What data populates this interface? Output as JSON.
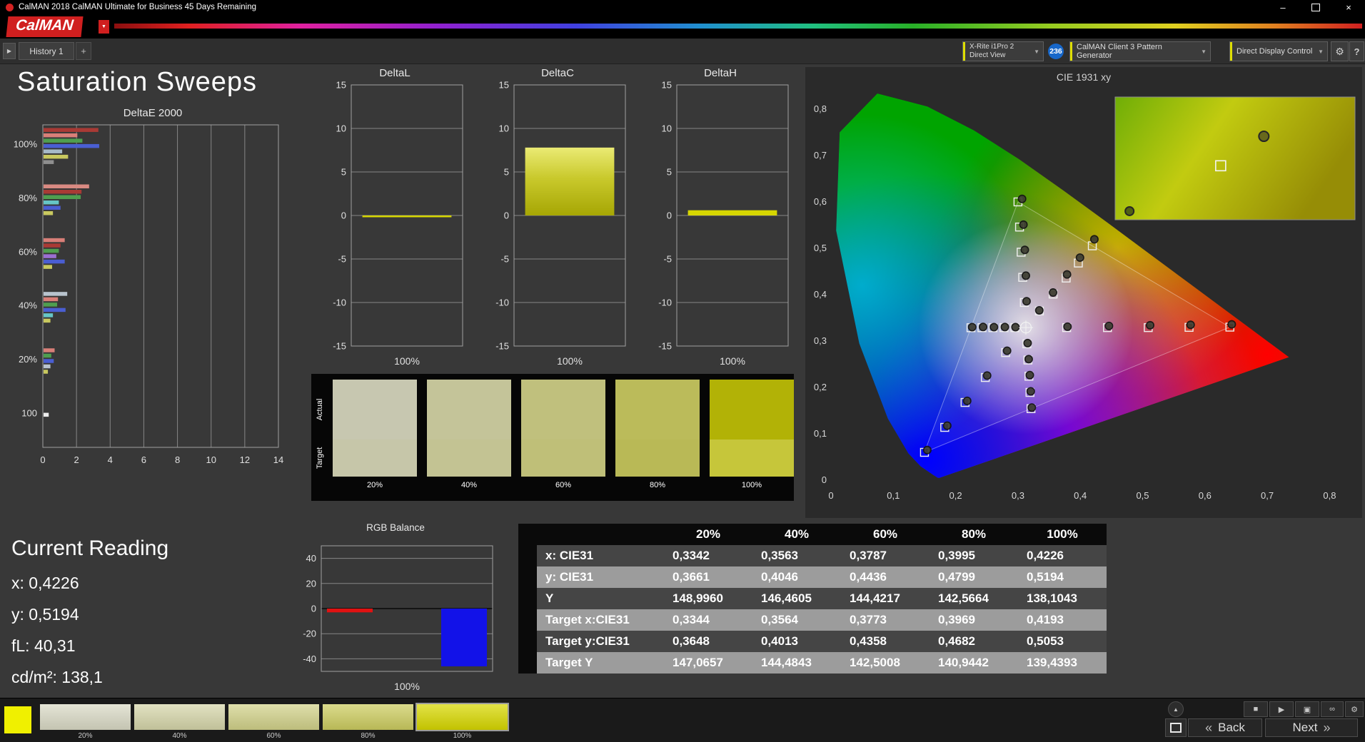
{
  "window": {
    "title": "CalMAN 2018 CalMAN Ultimate for Business 45 Days Remaining",
    "minimize": "–",
    "close": "×"
  },
  "brand": {
    "logo_text": "CalMAN",
    "dropdown_icon": "▼"
  },
  "toolbar": {
    "expander_icon": "▶",
    "history_tab": "History 1",
    "add_tab": "+",
    "meter_line1": "X-Rite i1Pro 2",
    "meter_line2": "Direct View",
    "badge": "236",
    "pattern_generator": "CalMAN Client 3 Pattern Generator",
    "display_control": "Direct Display Control",
    "dropdown_icon": "▼",
    "gear_icon": "⚙",
    "help_icon": "?"
  },
  "page": {
    "title": "Saturation Sweeps"
  },
  "current_reading": {
    "heading": "Current Reading",
    "lines": [
      "x: 0,4226",
      "y: 0,5194",
      "fL: 40,31",
      "cd/m²: 138,1"
    ]
  },
  "swatches": {
    "actual_label": "Actual",
    "target_label": "Target",
    "items": [
      {
        "label": "20%",
        "actual": "#c7c7b0",
        "target": "#c6c6a9"
      },
      {
        "label": "40%",
        "actual": "#c4c499",
        "target": "#c3c393"
      },
      {
        "label": "60%",
        "actual": "#c0c07d",
        "target": "#bfbf78"
      },
      {
        "label": "80%",
        "actual": "#bbbb5a",
        "target": "#b9b956"
      },
      {
        "label": "100%",
        "actual": "#b2b206",
        "target": "#c6c63a"
      }
    ]
  },
  "table": {
    "headers": [
      "20%",
      "40%",
      "60%",
      "80%",
      "100%"
    ],
    "rows": [
      {
        "label": "x: CIE31",
        "values": [
          "0,3342",
          "0,3563",
          "0,3787",
          "0,3995",
          "0,4226"
        ]
      },
      {
        "label": "y: CIE31",
        "values": [
          "0,3661",
          "0,4046",
          "0,4436",
          "0,4799",
          "0,5194"
        ]
      },
      {
        "label": "Y",
        "values": [
          "148,9960",
          "146,4605",
          "144,4217",
          "142,5664",
          "138,1043"
        ]
      },
      {
        "label": "Target x:CIE31",
        "values": [
          "0,3344",
          "0,3564",
          "0,3773",
          "0,3969",
          "0,4193"
        ]
      },
      {
        "label": "Target y:CIE31",
        "values": [
          "0,3648",
          "0,4013",
          "0,4358",
          "0,4682",
          "0,5053"
        ]
      },
      {
        "label": "Target Y",
        "values": [
          "147,0657",
          "144,4843",
          "142,5008",
          "140,9442",
          "139,4393"
        ]
      }
    ]
  },
  "bottom_bar": {
    "current_color": "#f0f000",
    "back_label": "Back",
    "next_label": "Next",
    "back_chevron": "«",
    "next_chevron": "»",
    "icons": {
      "collapse": "▲",
      "stop": "■",
      "play": "▶",
      "snapshot": "▣",
      "loop": "∞",
      "settings": "⚙"
    },
    "thumbnails": [
      {
        "label": "20%",
        "color": "#dadac6",
        "selected": false
      },
      {
        "label": "40%",
        "color": "#d6d6aa",
        "selected": false
      },
      {
        "label": "60%",
        "color": "#d2d28a",
        "selected": false
      },
      {
        "label": "80%",
        "color": "#cdcd60",
        "selected": false
      },
      {
        "label": "100%",
        "color": "#d8d800",
        "selected": true
      }
    ]
  },
  "chart_data": [
    {
      "id": "deltae2000",
      "type": "bar",
      "orientation": "horizontal",
      "title": "DeltaE 2000",
      "xlim": [
        0,
        14
      ],
      "xticks": [
        0,
        2,
        4,
        6,
        8,
        10,
        12,
        14
      ],
      "groups": [
        {
          "label": "100%",
          "bars": [
            {
              "color": "#a93a35",
              "value": 3.3
            },
            {
              "color": "#d97f78",
              "value": 2.05
            },
            {
              "color": "#4f9e4f",
              "value": 2.35
            },
            {
              "color": "#4a5ed2",
              "value": 3.35
            },
            {
              "color": "#a7bac9",
              "value": 1.15
            },
            {
              "color": "#c9c95f",
              "value": 1.5
            },
            {
              "color": "#8f8f8f",
              "value": 0.65
            }
          ]
        },
        {
          "label": "80%",
          "bars": [
            {
              "color": "#d98a82",
              "value": 2.75
            },
            {
              "color": "#a93a35",
              "value": 2.3
            },
            {
              "color": "#4f9e4f",
              "value": 2.25
            },
            {
              "color": "#66c6c6",
              "value": 0.95
            },
            {
              "color": "#4a5ed2",
              "value": 1.05
            },
            {
              "color": "#c9c95f",
              "value": 0.6
            }
          ]
        },
        {
          "label": "60%",
          "bars": [
            {
              "color": "#d97f78",
              "value": 1.3
            },
            {
              "color": "#a93a35",
              "value": 1.05
            },
            {
              "color": "#4f9e4f",
              "value": 0.95
            },
            {
              "color": "#9a6fd2",
              "value": 0.8
            },
            {
              "color": "#4a5ed2",
              "value": 1.3
            },
            {
              "color": "#c9c95f",
              "value": 0.55
            }
          ]
        },
        {
          "label": "40%",
          "bars": [
            {
              "color": "#b9c4ce",
              "value": 1.45
            },
            {
              "color": "#d97f78",
              "value": 0.9
            },
            {
              "color": "#4f9e4f",
              "value": 0.85
            },
            {
              "color": "#4a5ed2",
              "value": 1.35
            },
            {
              "color": "#66c6c6",
              "value": 0.6
            },
            {
              "color": "#c9c95f",
              "value": 0.45
            }
          ]
        },
        {
          "label": "20%",
          "bars": [
            {
              "color": "#d97f78",
              "value": 0.7
            },
            {
              "color": "#4f9e4f",
              "value": 0.5
            },
            {
              "color": "#4a5ed2",
              "value": 0.65
            },
            {
              "color": "#b9c4ce",
              "value": 0.45
            },
            {
              "color": "#c9c95f",
              "value": 0.3
            }
          ]
        },
        {
          "label": "100",
          "bars": [
            {
              "color": "#ececec",
              "value": 0.35
            }
          ]
        }
      ]
    },
    {
      "id": "deltal",
      "type": "bar",
      "title": "DeltaL",
      "ylim": [
        -15,
        15
      ],
      "yticks": [
        15,
        10,
        5,
        0,
        -5,
        -10,
        -15
      ],
      "xlabel": "100%",
      "bars": [
        {
          "value": -0.2,
          "color": "#d6d600"
        }
      ]
    },
    {
      "id": "deltac",
      "type": "bar",
      "title": "DeltaC",
      "ylim": [
        -15,
        15
      ],
      "yticks": [
        15,
        10,
        5,
        0,
        -5,
        -10,
        -15
      ],
      "xlabel": "100%",
      "bars": [
        {
          "value": 7.8,
          "color": "gradYellow"
        }
      ]
    },
    {
      "id": "deltah",
      "type": "bar",
      "title": "DeltaH",
      "ylim": [
        -15,
        15
      ],
      "yticks": [
        15,
        10,
        5,
        0,
        -5,
        -10,
        -15
      ],
      "xlabel": "100%",
      "bars": [
        {
          "value": 0.6,
          "color": "#d6d600"
        }
      ]
    },
    {
      "id": "rgb_balance",
      "type": "bar",
      "title": "RGB Balance",
      "ylim": [
        -50,
        50
      ],
      "yticks": [
        40,
        20,
        0,
        -20,
        -40
      ],
      "xlabel": "100%",
      "bars": [
        {
          "name": "red",
          "value": -3,
          "color": "#e01212"
        },
        {
          "name": "green",
          "value": 0,
          "color": "#12b412"
        },
        {
          "name": "blue",
          "value": -46,
          "color": "#1212e8"
        }
      ]
    },
    {
      "id": "cie1931",
      "type": "scatter",
      "title": "CIE 1931 xy",
      "xticks": [
        "0",
        "0,1",
        "0,2",
        "0,3",
        "0,4",
        "0,5",
        "0,6",
        "0,7",
        "0,8"
      ],
      "yticks": [
        "0",
        "0,1",
        "0,2",
        "0,3",
        "0,4",
        "0,5",
        "0,6",
        "0,7",
        "0,8"
      ],
      "white_point": [
        0.3127,
        0.329
      ],
      "gamut_triangle": [
        [
          0.64,
          0.33
        ],
        [
          0.3,
          0.6
        ],
        [
          0.15,
          0.06
        ]
      ],
      "sweeps": [
        {
          "name": "yellow-sweep",
          "target": [
            [
              0.3344,
              0.3648
            ],
            [
              0.3564,
              0.4013
            ],
            [
              0.3773,
              0.4358
            ],
            [
              0.3969,
              0.4682
            ],
            [
              0.4193,
              0.5053
            ]
          ],
          "measured": [
            [
              0.3342,
              0.3661
            ],
            [
              0.3563,
              0.4046
            ],
            [
              0.3787,
              0.4436
            ],
            [
              0.3995,
              0.4799
            ],
            [
              0.4226,
              0.5194
            ]
          ]
        },
        {
          "name": "red-sweep",
          "target": [
            [
              0.3781,
              0.329
            ],
            [
              0.4436,
              0.329
            ],
            [
              0.509,
              0.329
            ],
            [
              0.5745,
              0.3295
            ],
            [
              0.64,
              0.33
            ]
          ],
          "measured": [
            [
              0.3795,
              0.331
            ],
            [
              0.446,
              0.3325
            ],
            [
              0.512,
              0.334
            ],
            [
              0.577,
              0.335
            ],
            [
              0.643,
              0.336
            ]
          ]
        },
        {
          "name": "green-sweep",
          "target": [
            [
              0.3102,
              0.3832
            ],
            [
              0.3076,
              0.4374
            ],
            [
              0.3051,
              0.4916
            ],
            [
              0.3025,
              0.5458
            ],
            [
              0.3,
              0.6
            ]
          ],
          "measured": [
            [
              0.3138,
              0.3858
            ],
            [
              0.3127,
              0.441
            ],
            [
              0.311,
              0.4965
            ],
            [
              0.3088,
              0.551
            ],
            [
              0.3066,
              0.6065
            ]
          ]
        },
        {
          "name": "blue-sweep",
          "target": [
            [
              0.2802,
              0.2752
            ],
            [
              0.2476,
              0.2214
            ],
            [
              0.2151,
              0.1676
            ],
            [
              0.1825,
              0.1138
            ],
            [
              0.15,
              0.06
            ]
          ],
          "measured": [
            [
              0.2825,
              0.279
            ],
            [
              0.2505,
              0.2255
            ],
            [
              0.2185,
              0.171
            ],
            [
              0.1865,
              0.1175
            ],
            [
              0.1545,
              0.065
            ]
          ]
        },
        {
          "name": "cyan-sweep",
          "target": [
            [
              0.2951,
              0.3289
            ],
            [
              0.2775,
              0.3289
            ],
            [
              0.2598,
              0.3288
            ],
            [
              0.2422,
              0.3288
            ],
            [
              0.2246,
              0.3287
            ]
          ],
          "measured": [
            [
              0.296,
              0.33
            ],
            [
              0.279,
              0.3302
            ],
            [
              0.2615,
              0.33
            ],
            [
              0.244,
              0.3303
            ],
            [
              0.2265,
              0.33
            ]
          ]
        },
        {
          "name": "magenta-sweep",
          "target": [
            [
              0.3143,
              0.294
            ],
            [
              0.316,
              0.2591
            ],
            [
              0.3176,
              0.2241
            ],
            [
              0.3193,
              0.1892
            ],
            [
              0.3209,
              0.1542
            ]
          ],
          "measured": [
            [
              0.3155,
              0.2955
            ],
            [
              0.3172,
              0.261
            ],
            [
              0.319,
              0.2265
            ],
            [
              0.3205,
              0.1915
            ],
            [
              0.3222,
              0.1565
            ]
          ]
        }
      ],
      "inset": {
        "measured": [
          0.62,
          0.32
        ],
        "target": [
          0.44,
          0.56
        ],
        "extra": [
          0.06,
          0.93
        ]
      }
    }
  ]
}
